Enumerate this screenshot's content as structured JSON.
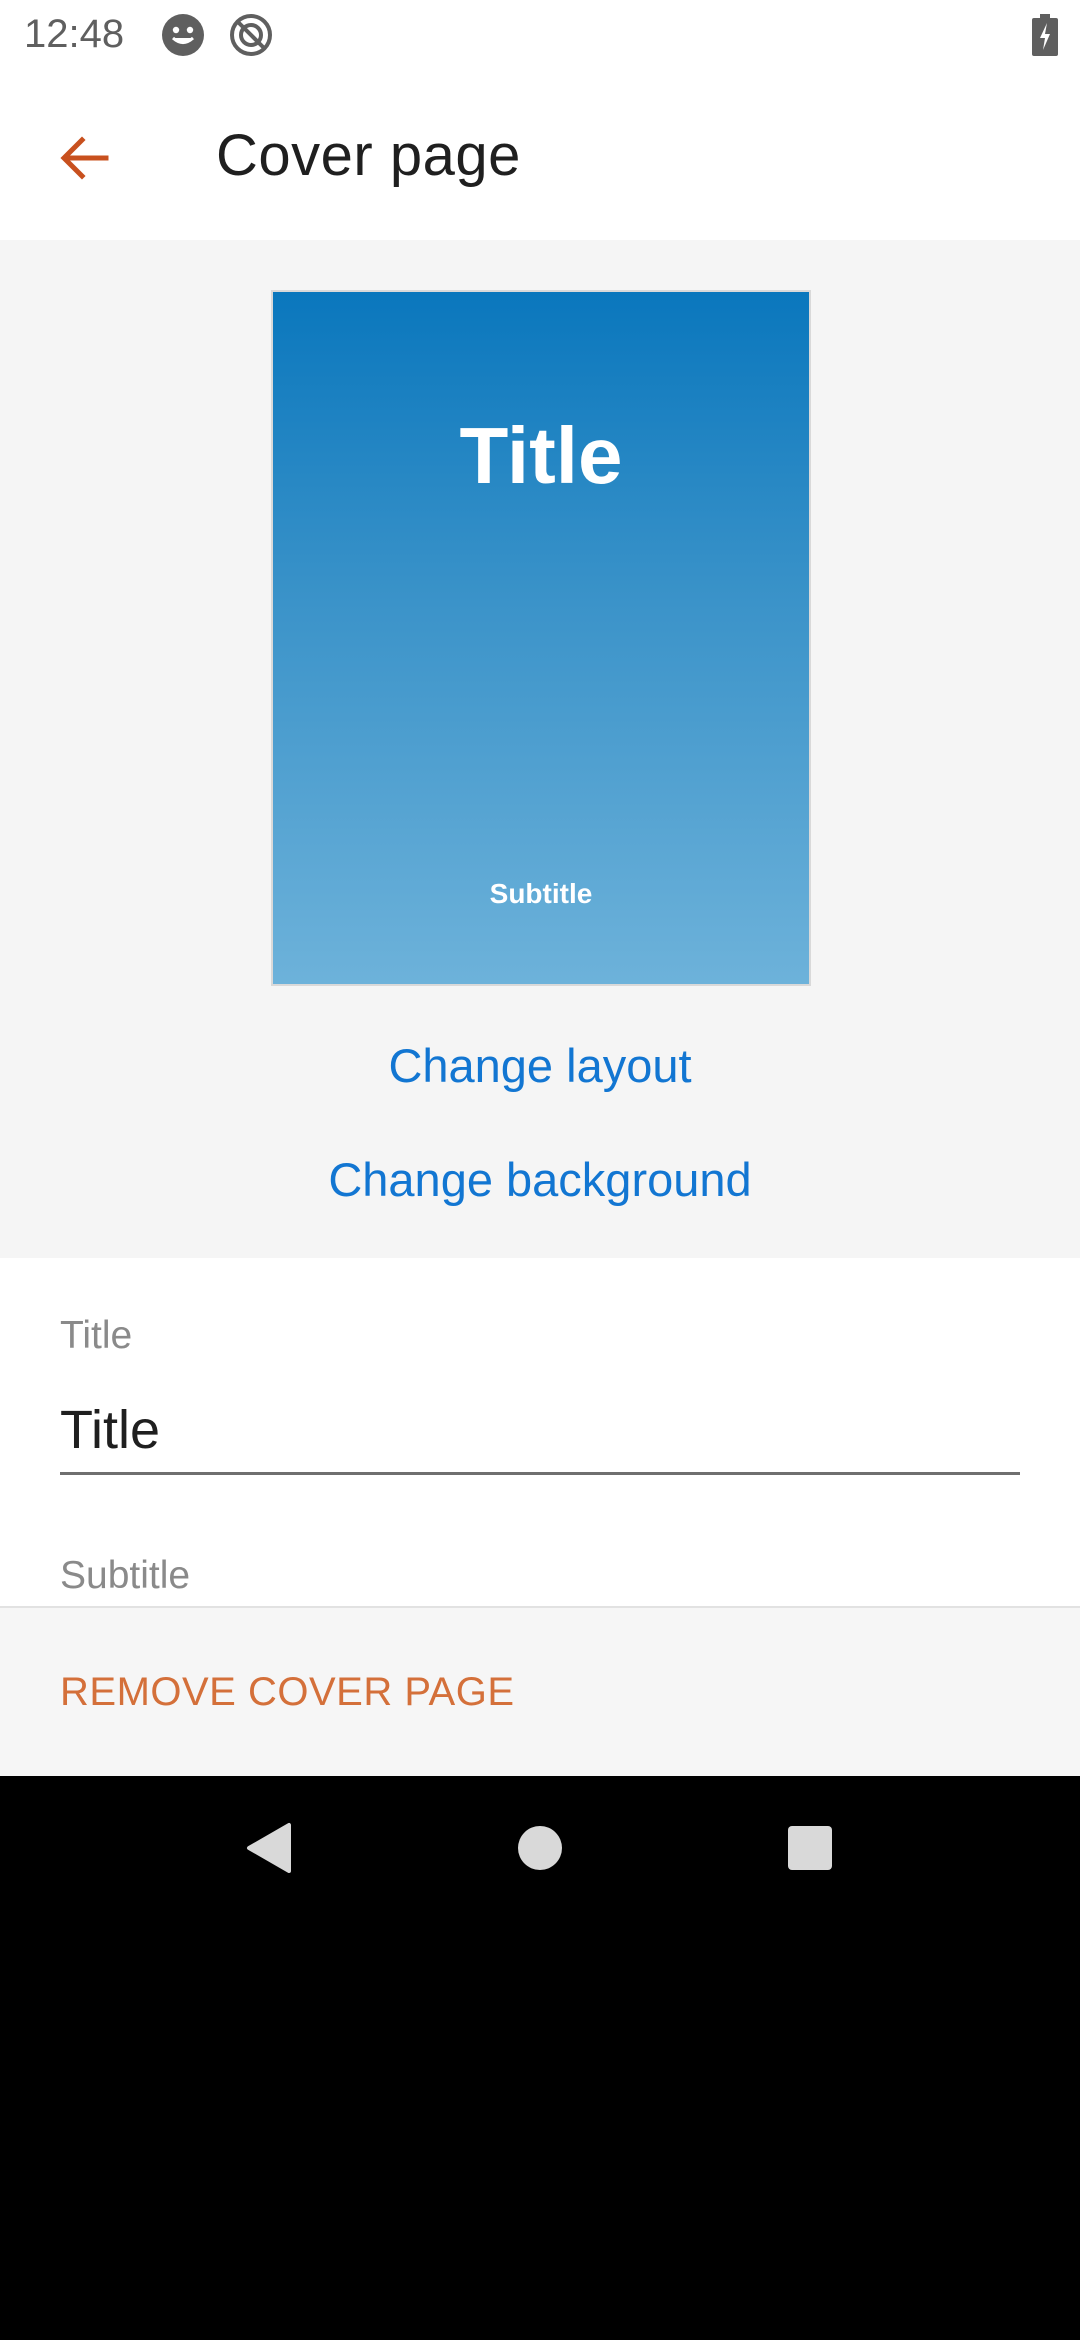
{
  "status_bar": {
    "time": "12:48",
    "icons": [
      "smiley-face-icon",
      "do-not-disturb-icon",
      "battery-charging-icon"
    ]
  },
  "app_bar": {
    "back_icon": "arrow-back-icon",
    "title": "Cover page",
    "accent_color": "#c8501e"
  },
  "preview": {
    "cover_title": "Title",
    "cover_subtitle": "Subtitle",
    "gradient_colors": [
      "#0a77bd",
      "#6db2da"
    ],
    "change_layout_label": "Change layout",
    "change_background_label": "Change background",
    "link_color": "#1276d2"
  },
  "form": {
    "title_label": "Title",
    "title_value": "Title",
    "subtitle_label": "Subtitle"
  },
  "actions": {
    "remove_label": "REMOVE COVER PAGE",
    "remove_color": "#d4703a"
  },
  "nav_bar": {
    "icons": [
      "nav-back-icon",
      "nav-home-icon",
      "nav-recents-icon"
    ]
  }
}
